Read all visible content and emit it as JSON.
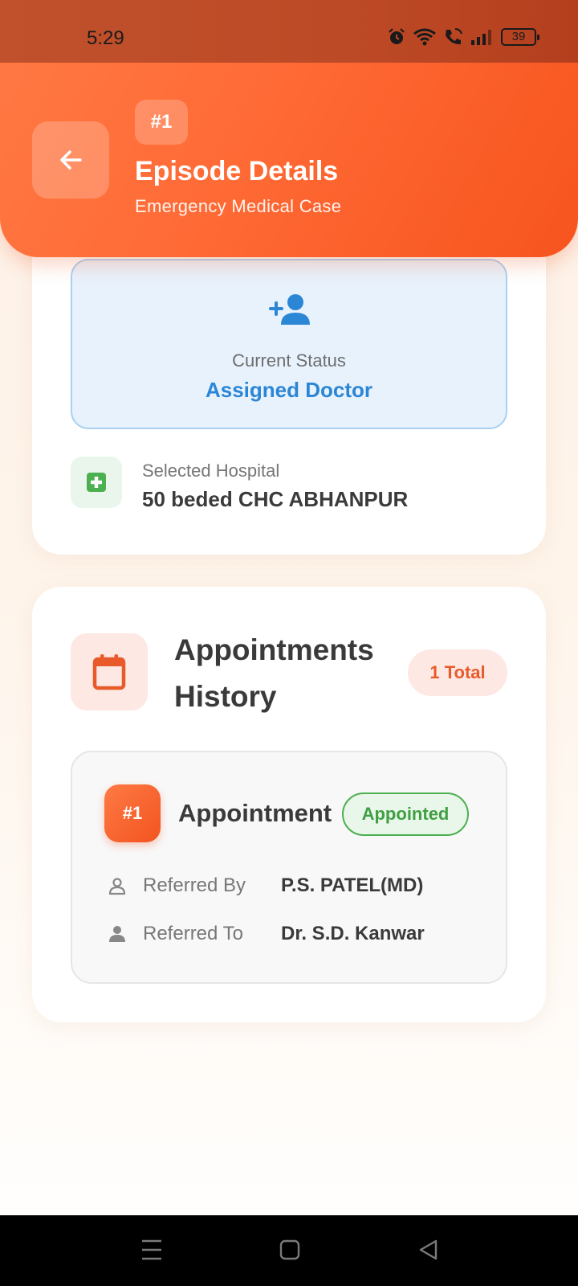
{
  "status_bar": {
    "time": "5:29",
    "battery": "39"
  },
  "header": {
    "episode_number": "#1",
    "title": "Episode Details",
    "subtitle": "Emergency Medical Case",
    "accent_color": "#ff6a35"
  },
  "current_status": {
    "label": "Current Status",
    "value": "Assigned Doctor",
    "icon": "person-add-icon"
  },
  "hospital": {
    "label": "Selected Hospital",
    "value": "50 beded CHC ABHANPUR",
    "icon": "medical-cross-icon"
  },
  "appointments": {
    "title": "Appointments History",
    "total": "1 Total",
    "icon": "calendar-icon",
    "items": [
      {
        "number": "#1",
        "label": "Appointment",
        "status": "Appointed",
        "referred_by_label": "Referred By",
        "referred_by_value": "P.S. PATEL(MD)",
        "referred_to_label": "Referred To",
        "referred_to_value": "Dr. S.D. Kanwar"
      }
    ]
  },
  "nav": {
    "icons": [
      "menu-icon",
      "home-square-icon",
      "back-triangle-icon"
    ]
  }
}
